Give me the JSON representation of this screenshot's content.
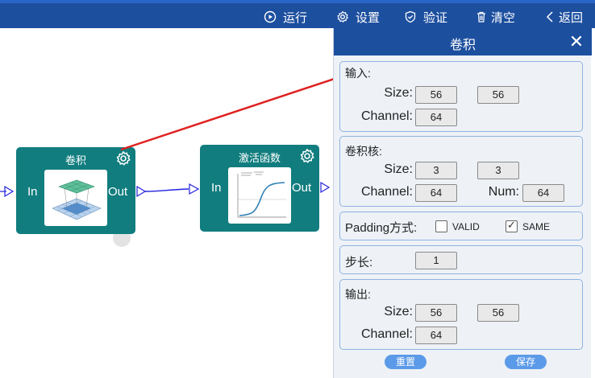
{
  "toolbar": {
    "run": "运行",
    "settings": "设置",
    "verify": "验证",
    "clear": "清空",
    "back": "返回"
  },
  "nodes": {
    "conv": {
      "title": "卷积",
      "in": "In",
      "out": "Out"
    },
    "act": {
      "title": "激活函数",
      "in": "In",
      "out": "Out"
    }
  },
  "panel": {
    "title": "卷积",
    "close": "✕",
    "input": {
      "label": "输入:",
      "size_label": "Size:",
      "size_w": "56",
      "size_h": "56",
      "channel_label": "Channel:",
      "channel": "64"
    },
    "kernel": {
      "label": "卷积核:",
      "size_label": "Size:",
      "size_w": "3",
      "size_h": "3",
      "channel_label": "Channel:",
      "channel": "64",
      "num_label": "Num:",
      "num": "64"
    },
    "padding": {
      "label": "Padding方式:",
      "valid": "VALID",
      "same": "SAME",
      "valid_checked": false,
      "same_checked": true
    },
    "stride": {
      "label": "步长:",
      "value": "1"
    },
    "output": {
      "label": "输出:",
      "size_label": "Size:",
      "size_w": "56",
      "size_h": "56",
      "channel_label": "Channel:",
      "channel": "64"
    },
    "reset": "重置",
    "save": "保存"
  },
  "colors": {
    "toolbar": "#1d4f9f",
    "node": "#117d7e",
    "wire": "#2222dd",
    "pointer_arrow": "#e02020",
    "button": "#5b9ae8"
  }
}
